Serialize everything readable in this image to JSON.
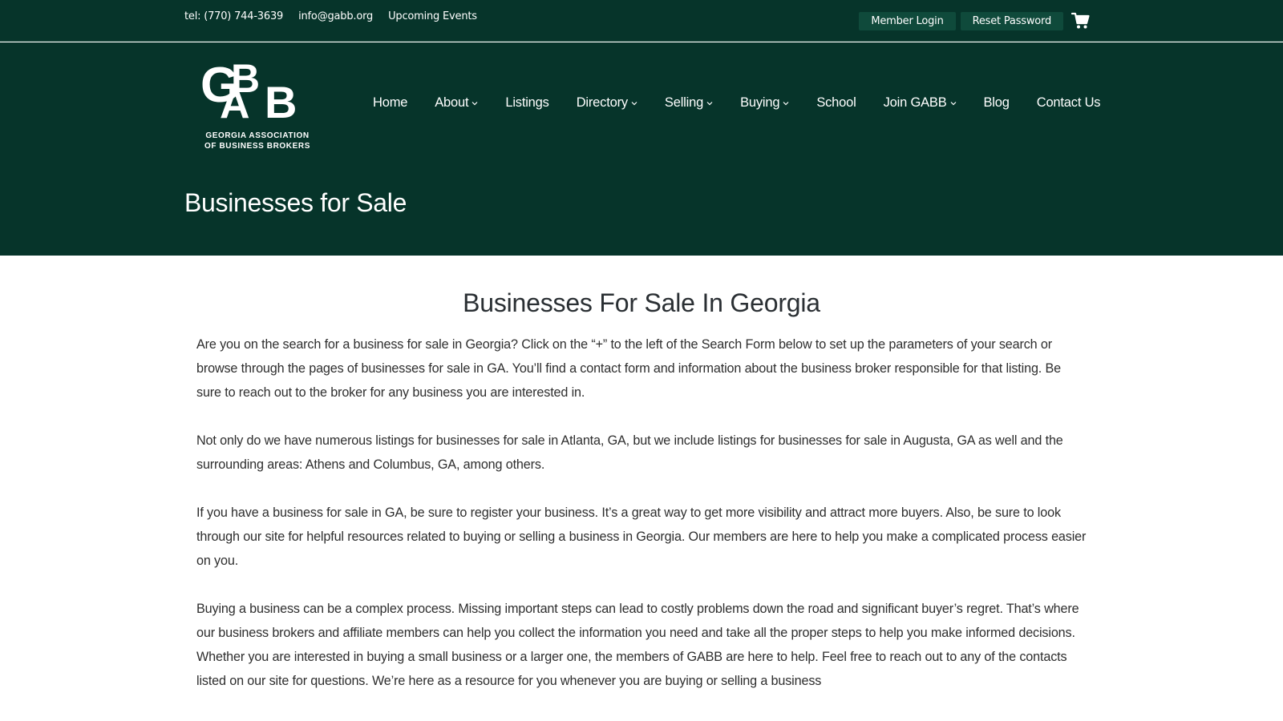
{
  "topbar": {
    "phone": "tel: (770) 744-3639",
    "email": "info@gabb.org",
    "events": "Upcoming Events",
    "member_login": "Member Login",
    "reset_password": "Reset Password",
    "cart_icon": "shopping-cart-icon"
  },
  "logo": {
    "letters": "GABB",
    "line1": "GEORGIA ASSOCIATION",
    "line2": "OF BUSINESS BROKERS"
  },
  "nav": {
    "items": [
      {
        "label": "Home",
        "dropdown": false
      },
      {
        "label": "About",
        "dropdown": true
      },
      {
        "label": "Listings",
        "dropdown": false
      },
      {
        "label": "Directory",
        "dropdown": true
      },
      {
        "label": "Selling",
        "dropdown": true
      },
      {
        "label": "Buying",
        "dropdown": true
      },
      {
        "label": "School",
        "dropdown": false
      },
      {
        "label": "Join GABB",
        "dropdown": true
      },
      {
        "label": "Blog",
        "dropdown": false
      },
      {
        "label": "Contact Us",
        "dropdown": false
      }
    ]
  },
  "header": {
    "page_title": "Businesses for Sale"
  },
  "main": {
    "heading": "Businesses For Sale In Georgia",
    "paragraphs": [
      "Are you on the search for a business for sale in Georgia? Click on the “+” to the left of the Search Form below to set up the parameters of your search or browse through the pages of businesses for sale in GA. You’ll find a contact form and information about the business broker responsible for that listing. Be sure to reach out to the broker for any business you are interested in.",
      "Not only do we have numerous listings for businesses for sale in Atlanta, GA, but we include listings for businesses for sale in Augusta, GA as well and the surrounding areas: Athens and Columbus, GA, among others.",
      "If you have a business for sale in GA, be sure to register your business. It’s a great way to get more visibility and attract more buyers. Also, be sure to look through our site for helpful resources related to buying or selling a business in Georgia. Our members are here to help you make a complicated process easier on you.",
      "Buying a business can be a complex process. Missing important steps can lead to costly problems down the road and significant buyer’s regret. That’s where our business brokers and affiliate members can help you collect the information you need and take all the proper steps to help you make informed decisions. Whether you are interested in buying a small business or a larger one, the members of GABB are here to help. Feel free to reach out to any of the contacts listed on our site for questions. We’re here as a resource for you whenever you are buying or selling a business"
    ]
  },
  "colors": {
    "header_bg": "#06342a",
    "button_bg": "#0f4a3b",
    "text": "#2e2e2e"
  }
}
